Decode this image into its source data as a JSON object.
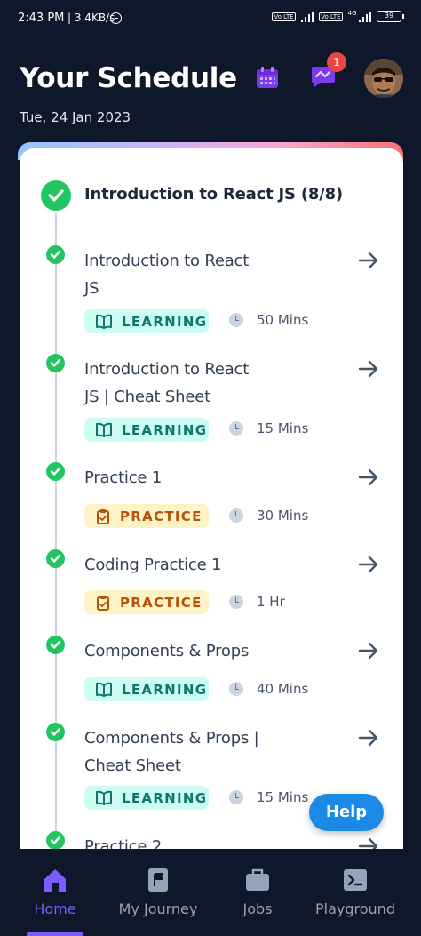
{
  "status_bar": {
    "time": "2:43 PM",
    "network_speed": "3.4KB/s",
    "battery": "39",
    "volte_1": "Vo LTE",
    "volte_2": "Vo LTE",
    "network_type": "4G"
  },
  "header": {
    "title": "Your Schedule",
    "date": "Tue, 24 Jan 2023",
    "notification_count": "1",
    "icons": [
      "calendar-icon",
      "chat-icon",
      "avatar"
    ]
  },
  "course": {
    "title": "Introduction to React JS (8/8)",
    "status": "completed"
  },
  "items": [
    {
      "title": "Introduction to React JS",
      "tag": "LEARNING",
      "duration": "50 Mins"
    },
    {
      "title": "Introduction to React JS | Cheat Sheet",
      "tag": "LEARNING",
      "duration": "15 Mins"
    },
    {
      "title": "Practice 1",
      "tag": "PRACTICE",
      "duration": "30 Mins"
    },
    {
      "title": "Coding Practice 1",
      "tag": "PRACTICE",
      "duration": "1 Hr"
    },
    {
      "title": "Components & Props",
      "tag": "LEARNING",
      "duration": "40 Mins"
    },
    {
      "title": "Components & Props | Cheat Sheet",
      "tag": "LEARNING",
      "duration": "15 Mins"
    },
    {
      "title": "Practice 2",
      "tag": "",
      "duration": ""
    }
  ],
  "help_button": "Help",
  "bottom_nav": [
    {
      "label": "Home",
      "icon": "home-icon",
      "active": true
    },
    {
      "label": "My Journey",
      "icon": "flag-icon",
      "active": false
    },
    {
      "label": "Jobs",
      "icon": "briefcase-icon",
      "active": false
    },
    {
      "label": "Playground",
      "icon": "terminal-icon",
      "active": false
    }
  ],
  "colors": {
    "background": "#0f172a",
    "accent": "#7c5cff",
    "success": "#22c55e",
    "learning_bg": "#ccfbf1",
    "learning_text": "#0f766e",
    "practice_bg": "#fef3c7",
    "practice_text": "#b45309",
    "help": "#1a8ae6",
    "badge": "#ef4444"
  }
}
